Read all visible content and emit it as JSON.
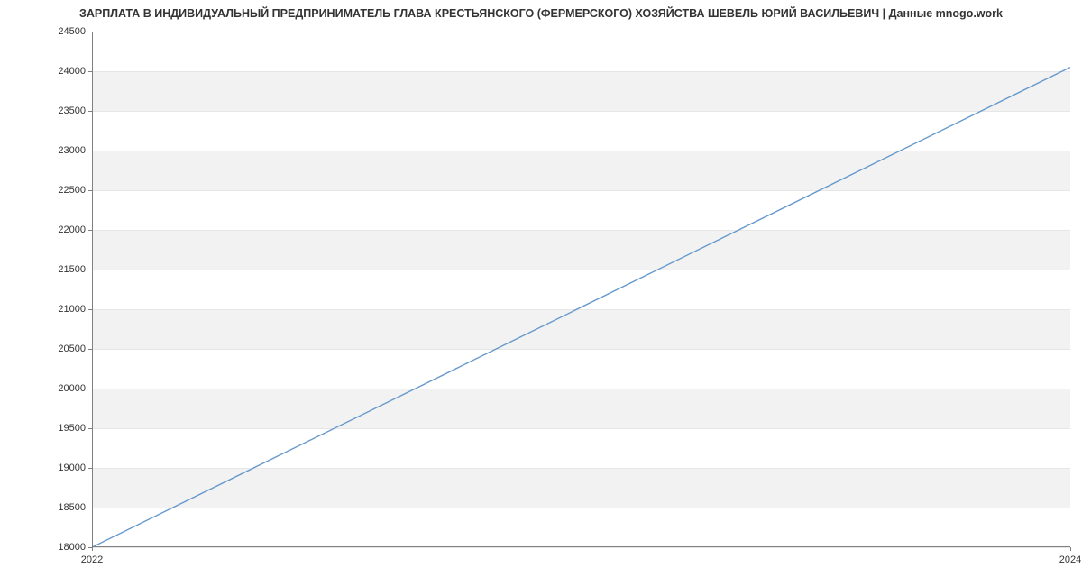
{
  "chart_data": {
    "type": "line",
    "title": "ЗАРПЛАТА В ИНДИВИДУАЛЬНЫЙ ПРЕДПРИНИМАТЕЛЬ ГЛАВА КРЕСТЬЯНСКОГО (ФЕРМЕРСКОГО) ХОЗЯЙСТВА ШЕВЕЛЬ ЮРИЙ ВАСИЛЬЕВИЧ | Данные mnogo.work",
    "x": [
      2022,
      2024
    ],
    "values": [
      18000,
      24050
    ],
    "xlabel": "",
    "ylabel": "",
    "x_ticks": [
      2022,
      2024
    ],
    "y_ticks": [
      18000,
      18500,
      19000,
      19500,
      20000,
      20500,
      21000,
      21500,
      22000,
      22500,
      23000,
      23500,
      24000,
      24500
    ],
    "xlim": [
      2022,
      2024
    ],
    "ylim": [
      18000,
      24500
    ],
    "line_color": "#6699cc",
    "grid": true
  }
}
